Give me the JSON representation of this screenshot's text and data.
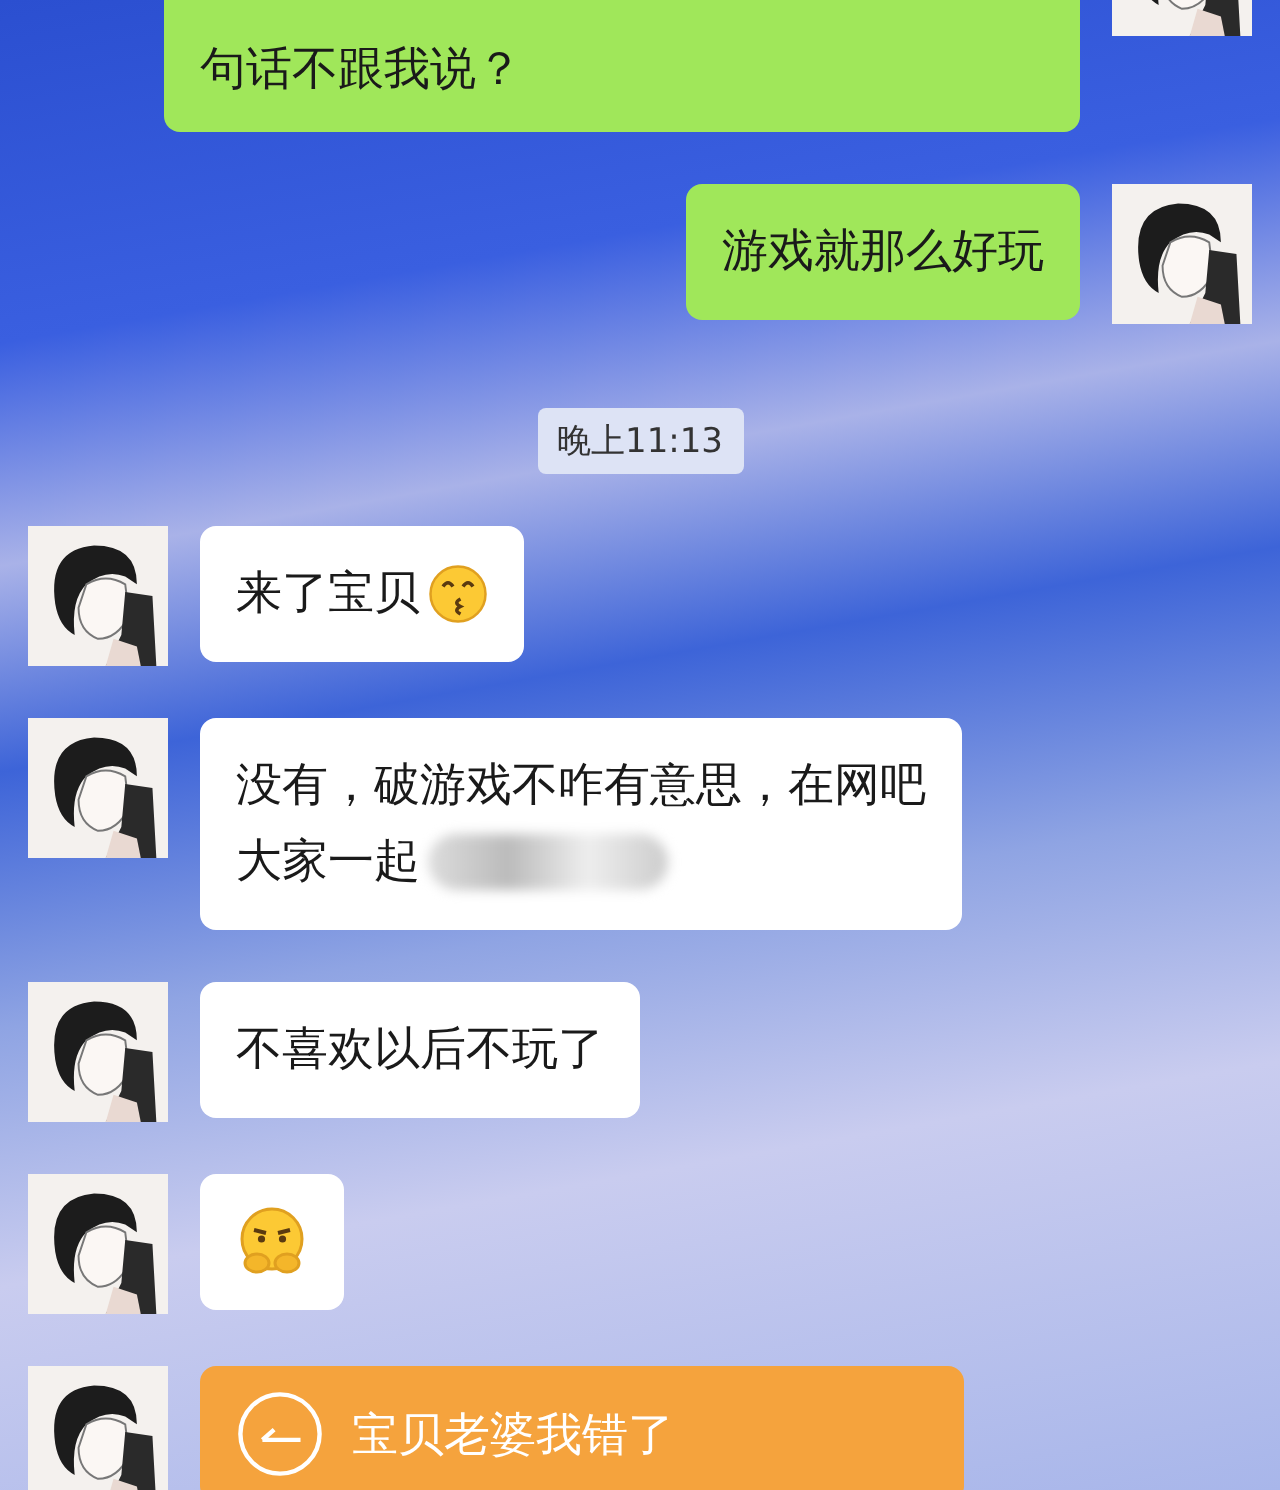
{
  "messages": [
    {
      "kind": "text",
      "outgoing": true,
      "lines": [
        "句话不跟我说？"
      ],
      "cut_top": true
    },
    {
      "kind": "text",
      "outgoing": true,
      "lines": [
        "游戏就那么好玩"
      ]
    },
    {
      "kind": "time",
      "text": "晚上11:13"
    },
    {
      "kind": "text",
      "outgoing": false,
      "lines": [
        "来了宝贝"
      ],
      "trailing_emoji": true
    },
    {
      "kind": "text",
      "outgoing": false,
      "lines": [
        "没有，破游戏不咋有意思，在网吧",
        "大家一起"
      ],
      "blurred": true
    },
    {
      "kind": "text",
      "outgoing": false,
      "lines": [
        "不喜欢以后不玩了"
      ]
    },
    {
      "kind": "sticker",
      "outgoing": false
    },
    {
      "kind": "transfer",
      "outgoing": false,
      "text": "宝贝老婆我错了"
    }
  ]
}
